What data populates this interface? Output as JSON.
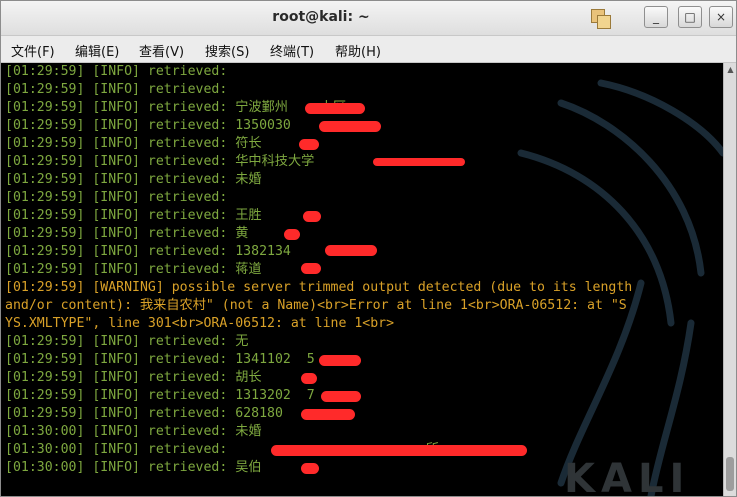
{
  "window": {
    "title": "root@kali: ~",
    "controls": {
      "minimize": "_",
      "maximize": "□",
      "close": "×"
    }
  },
  "menubar": {
    "items": [
      {
        "label": "文件(F)"
      },
      {
        "label": "编辑(E)"
      },
      {
        "label": "查看(V)"
      },
      {
        "label": "搜索(S)"
      },
      {
        "label": "终端(T)"
      },
      {
        "label": "帮助(H)"
      }
    ]
  },
  "terminal": {
    "lines": [
      {
        "text": "[01:29:59] [INFO] retrieved:",
        "kind": "info"
      },
      {
        "text": "[01:29:59] [INFO] retrieved:",
        "kind": "info"
      },
      {
        "text": "[01:29:59] [INFO] retrieved: 宁波鄞州    小区",
        "kind": "info"
      },
      {
        "text": "[01:29:59] [INFO] retrieved: 1350030",
        "kind": "info"
      },
      {
        "text": "[01:29:59] [INFO] retrieved: 符长",
        "kind": "info"
      },
      {
        "text": "[01:29:59] [INFO] retrieved: 华中科技大学",
        "kind": "info"
      },
      {
        "text": "[01:29:59] [INFO] retrieved: 未婚",
        "kind": "info"
      },
      {
        "text": "[01:29:59] [INFO] retrieved:",
        "kind": "info"
      },
      {
        "text": "[01:29:59] [INFO] retrieved: 王胜",
        "kind": "info"
      },
      {
        "text": "[01:29:59] [INFO] retrieved: 黄",
        "kind": "info"
      },
      {
        "text": "[01:29:59] [INFO] retrieved: 1382134",
        "kind": "info"
      },
      {
        "text": "[01:29:59] [INFO] retrieved: 蒋道",
        "kind": "info"
      },
      {
        "text": "[01:29:59] [WARNING] possible server trimmed output detected (due to its length",
        "kind": "warn"
      },
      {
        "text": "and/or content): 我来自农村\" (not a Name)<br>Error at line 1<br>ORA-06512: at \"S",
        "kind": "warn"
      },
      {
        "text": "YS.XMLTYPE\", line 301<br>ORA-06512: at line 1<br>",
        "kind": "warn"
      },
      {
        "text": "[01:29:59] [INFO] retrieved: 无",
        "kind": "info"
      },
      {
        "text": "[01:29:59] [INFO] retrieved: 1341102  5",
        "kind": "info"
      },
      {
        "text": "[01:29:59] [INFO] retrieved: 胡长",
        "kind": "info"
      },
      {
        "text": "[01:29:59] [INFO] retrieved: 1313202  7",
        "kind": "info"
      },
      {
        "text": "[01:29:59] [INFO] retrieved: 628180",
        "kind": "info"
      },
      {
        "text": "[01:30:00] [INFO] retrieved: 未婚",
        "kind": "info"
      },
      {
        "text": "[01:30:00] [INFO] retrieved:                         所",
        "kind": "info"
      },
      {
        "text": "[01:30:00] [INFO] retrieved: 吴伯",
        "kind": "info"
      }
    ]
  },
  "watermark": {
    "text": "KALI"
  },
  "colors": {
    "info": "#7ea83f",
    "warn": "#d9a128",
    "redaction": "#ff2a2a",
    "background": "#000000"
  }
}
